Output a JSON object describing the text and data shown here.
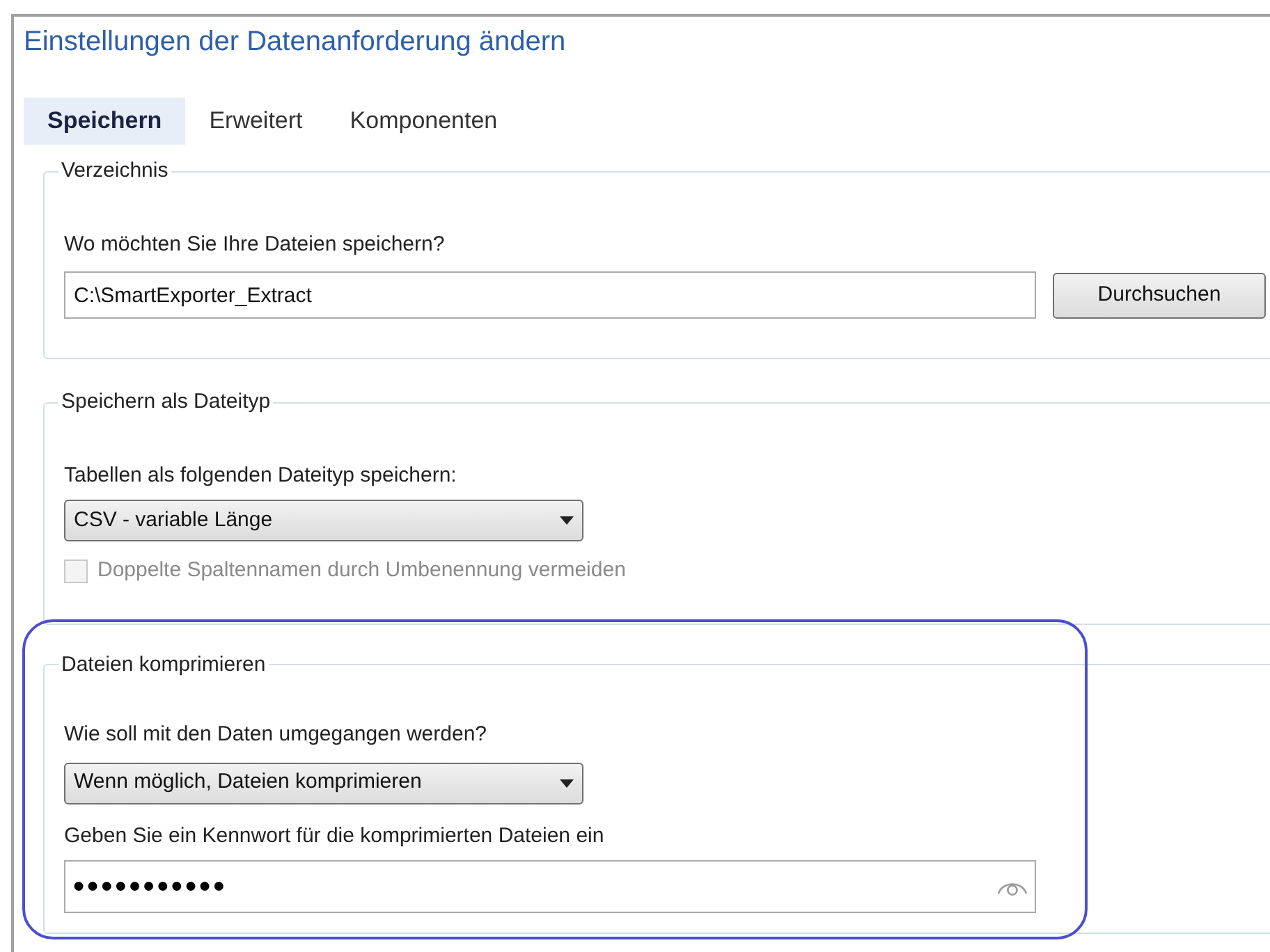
{
  "window": {
    "title": "Einstellungen der Datenanforderung ändern"
  },
  "tabs": [
    {
      "label": "Speichern",
      "selected": true
    },
    {
      "label": "Erweitert",
      "selected": false
    },
    {
      "label": "Komponenten",
      "selected": false
    }
  ],
  "directory": {
    "legend": "Verzeichnis",
    "label": "Wo möchten Sie Ihre Dateien speichern?",
    "value": "C:\\SmartExporter_Extract",
    "button": "Durchsuchen"
  },
  "file_type": {
    "legend": "Speichern als Dateityp",
    "label": "Tabellen als folgenden Dateityp speichern:",
    "dropdown": "CSV - variable Länge",
    "checkbox": {
      "label": "Doppelte Spaltennamen durch Umbenennung vermeiden",
      "checked": false,
      "disabled": true
    }
  },
  "compress": {
    "legend": "Dateien komprimieren",
    "highlighted": true,
    "label": "Wie soll mit den Daten umgegangen werden?",
    "dropdown": "Wenn möglich, Dateien komprimieren",
    "password_label": "Geben Sie ein Kennwort für die komprimierten Dateien ein",
    "password": "●●●●●●●●●●●"
  }
}
